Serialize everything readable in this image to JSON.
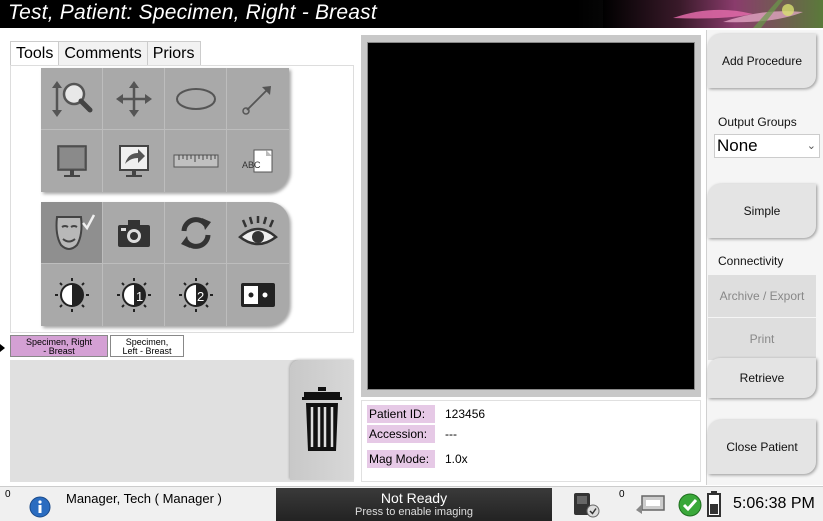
{
  "window": {
    "title": "Test, Patient:  Specimen, Right - Breast"
  },
  "tabs": [
    {
      "label": "Tools",
      "active": true
    },
    {
      "label": "Comments",
      "active": false
    },
    {
      "label": "Priors",
      "active": false
    }
  ],
  "tools": {
    "group1": [
      "zoom-icon",
      "pan-icon",
      "ellipse-roi-icon",
      "arrow-annotation-icon",
      "monitor-icon",
      "export-monitor-icon",
      "ruler-icon",
      "text-annotation-icon"
    ],
    "group2": [
      "face-review-icon",
      "camera-icon",
      "refresh-icon",
      "eye-icon",
      "contrast-icon",
      "contrast-1-icon",
      "contrast-2-icon",
      "invert-icon"
    ],
    "ruler_text": "ABC",
    "contrast_1_label": "1",
    "contrast_2_label": "2"
  },
  "specimens": [
    {
      "label_line1": "Specimen, Right",
      "label_line2": "- Breast",
      "selected": true
    },
    {
      "label_line1": "Specimen,",
      "label_line2": "Left - Breast",
      "selected": false
    }
  ],
  "patient_info": {
    "patient_id_label": "Patient ID:",
    "patient_id_value": "123456",
    "accession_label": "Accession:",
    "accession_value": "---",
    "mag_mode_label": "Mag Mode:",
    "mag_mode_value": "1.0x"
  },
  "right_panel": {
    "add_procedure": "Add Procedure",
    "output_groups_label": "Output Groups",
    "output_groups_value": "None",
    "simple": "Simple",
    "connectivity_label": "Connectivity",
    "archive_export": "Archive / Export",
    "print": "Print",
    "retrieve": "Retrieve",
    "close_patient": "Close Patient"
  },
  "status_bar": {
    "left_count": "0",
    "user": "Manager, Tech ( Manager )",
    "ready_title": "Not Ready",
    "ready_subtitle": "Press to enable imaging",
    "count2": "0",
    "time": "5:06:38 PM"
  },
  "colors": {
    "accent_purple": "#d4a0d4",
    "label_pink": "#e6c9e6",
    "tool_gray": "#a9a9a9"
  }
}
